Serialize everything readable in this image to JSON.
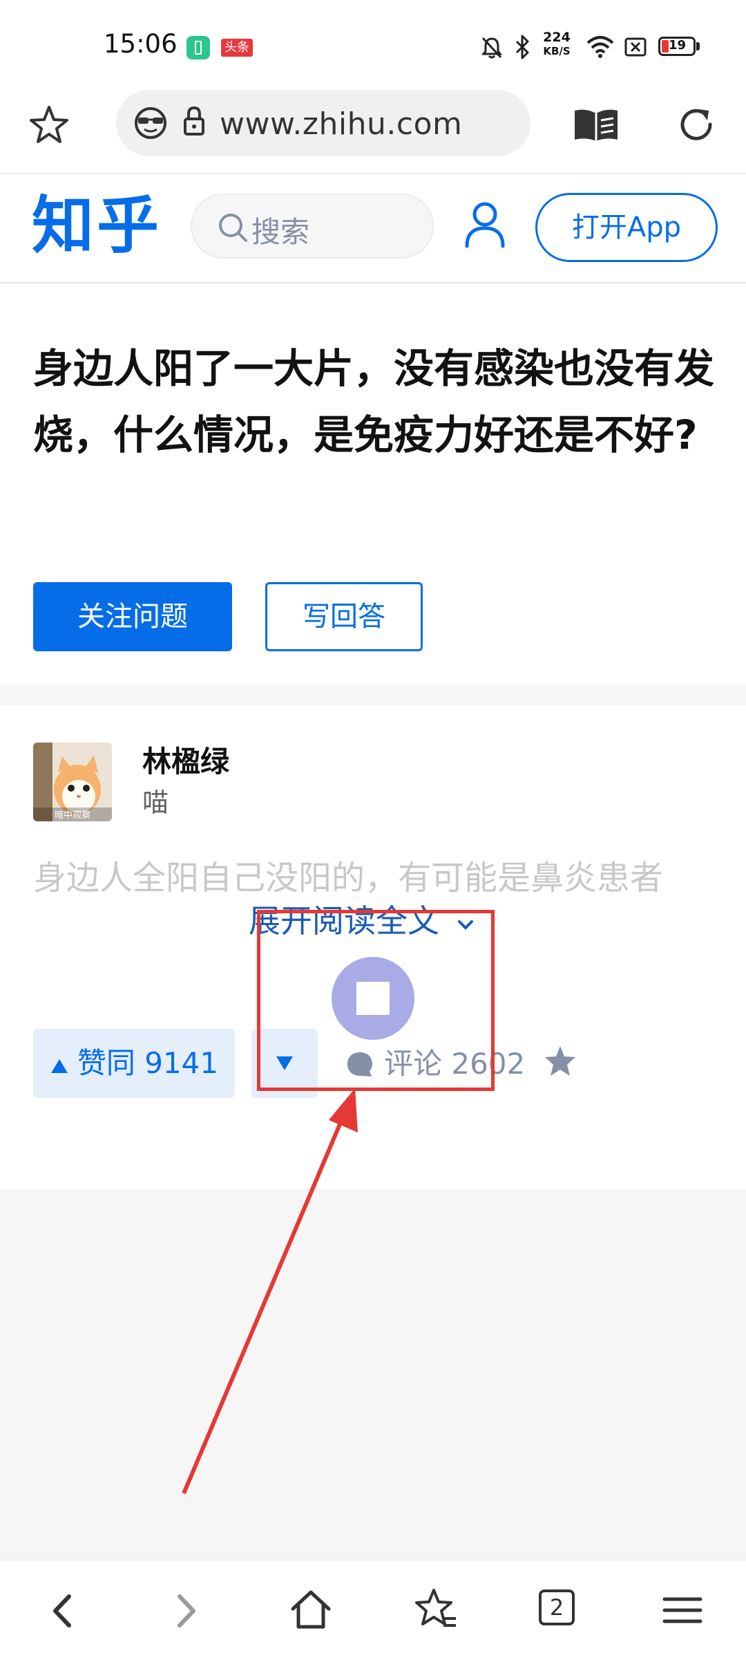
{
  "status_bar": {
    "time": "15:06",
    "notif_app_label": "头条",
    "net_speed_value": "224",
    "net_speed_unit": "KB/S",
    "battery": "19"
  },
  "browser": {
    "url": "www.zhihu.com",
    "tab_count": "2"
  },
  "zhihu": {
    "logo": "知乎",
    "search_placeholder": "搜索",
    "open_app": "打开App"
  },
  "question": {
    "title": "身边人阳了一大片，没有感染也没有发烧，什么情况，是免疫力好还是不好?",
    "follow_label": "关注问题",
    "answer_label": "写回答"
  },
  "answer": {
    "author_name": "林楹绿",
    "author_bio": "喵",
    "avatar_caption": "暗中观察",
    "excerpt": "身边人全阳自己没阳的，有可能是鼻炎患者",
    "expand_label": "展开阅读全文",
    "upvote_label": "赞同 9141",
    "comment_label": "评论 2602"
  },
  "colors": {
    "brand": "#056de8",
    "annotation": "#e53935"
  }
}
